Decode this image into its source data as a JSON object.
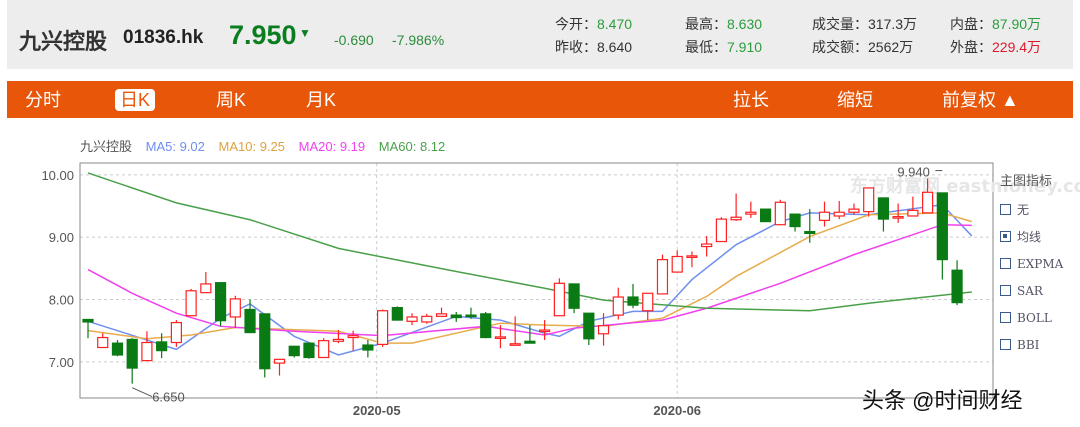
{
  "header": {
    "name": "九兴控股",
    "code": "01836.hk",
    "price": "7.950",
    "direction_icon": "▼",
    "change": "-0.690",
    "change_pct": "-7.986%",
    "stats": [
      {
        "label": "今开：",
        "value": "8.470",
        "color": "green"
      },
      {
        "label": "最高：",
        "value": "8.630",
        "color": "green"
      },
      {
        "label": "成交量：",
        "value": "317.3万",
        "color": "neutral"
      },
      {
        "label": "内盘：",
        "value": "87.90万",
        "color": "green"
      },
      {
        "label": "昨收：",
        "value": "8.640",
        "color": "neutral"
      },
      {
        "label": "最低：",
        "value": "7.910",
        "color": "green"
      },
      {
        "label": "成交额：",
        "value": "2562万",
        "color": "neutral"
      },
      {
        "label": "外盘：",
        "value": "229.4万",
        "color": "red"
      }
    ]
  },
  "toolbar": {
    "tabs": [
      "分时",
      "日K",
      "周K",
      "月K"
    ],
    "active_tab": "日K",
    "actions": [
      "拉长",
      "缩短",
      "前复权 ▲"
    ]
  },
  "legend": {
    "name": "九兴控股",
    "ma5": "MA5: 9.02",
    "ma10": "MA10: 9.25",
    "ma20": "MA20: 9.19",
    "ma60": "MA60: 8.12"
  },
  "indicators": {
    "title": "主图指标",
    "options": [
      {
        "label": "无",
        "checked": false
      },
      {
        "label": "均线",
        "checked": true
      },
      {
        "label": "EXPMA",
        "checked": false
      },
      {
        "label": "SAR",
        "checked": false
      },
      {
        "label": "BOLL",
        "checked": false
      },
      {
        "label": "BBI",
        "checked": false
      }
    ]
  },
  "watermark": "头条 @时间财经",
  "chart_watermark": "东方财富网 eastmoney.com",
  "colors": {
    "up": "#ff2020",
    "down": "#0a7a14",
    "ma5": "#6f8fef",
    "ma10": "#e8ac4c",
    "ma20": "#f040f0",
    "ma60": "#4aa04a",
    "accent": "#e8560a"
  },
  "chart_data": {
    "type": "candlestick",
    "ylim": [
      6.42,
      10.19
    ],
    "yticks": [
      "10.00",
      "9.00",
      "8.00",
      "7.00"
    ],
    "ytick_values": [
      10,
      9,
      8,
      7
    ],
    "xticks": [
      {
        "label": "2020-05",
        "index": 19.6
      },
      {
        "label": "2020-06",
        "index": 40
      }
    ],
    "annotations": [
      {
        "text": "6.650",
        "index": 3,
        "value": 6.65
      },
      {
        "text": "9.940",
        "index": 58,
        "value": 9.94
      }
    ],
    "candles": [
      [
        7.68,
        7.68,
        7.38,
        7.64
      ],
      [
        7.23,
        7.46,
        7.23,
        7.39
      ],
      [
        7.3,
        7.35,
        7.09,
        7.11
      ],
      [
        7.36,
        7.38,
        6.65,
        6.9
      ],
      [
        7.02,
        7.49,
        7.02,
        7.31
      ],
      [
        7.32,
        7.46,
        7.06,
        7.18
      ],
      [
        7.31,
        7.67,
        7.24,
        7.63
      ],
      [
        7.74,
        8.17,
        7.74,
        8.14
      ],
      [
        8.11,
        8.44,
        8.11,
        8.25
      ],
      [
        8.27,
        8.27,
        7.57,
        7.66
      ],
      [
        7.72,
        8.06,
        7.54,
        8.01
      ],
      [
        7.84,
        8.0,
        7.46,
        7.47
      ],
      [
        7.77,
        7.77,
        6.75,
        6.89
      ],
      [
        6.98,
        7.04,
        6.78,
        7.04
      ],
      [
        7.25,
        7.25,
        7.07,
        7.1
      ],
      [
        7.3,
        7.3,
        7.05,
        7.07
      ],
      [
        7.07,
        7.38,
        7.07,
        7.34
      ],
      [
        7.33,
        7.51,
        7.3,
        7.36
      ],
      [
        7.39,
        7.5,
        7.18,
        7.42
      ],
      [
        7.27,
        7.35,
        7.07,
        7.19
      ],
      [
        7.28,
        7.84,
        7.24,
        7.82
      ],
      [
        7.87,
        7.89,
        7.67,
        7.67
      ],
      [
        7.65,
        7.78,
        7.59,
        7.72
      ],
      [
        7.64,
        7.77,
        7.61,
        7.73
      ],
      [
        7.73,
        7.87,
        7.73,
        7.77
      ],
      [
        7.75,
        7.8,
        7.64,
        7.71
      ],
      [
        7.75,
        7.87,
        7.69,
        7.73
      ],
      [
        7.77,
        7.8,
        7.38,
        7.39
      ],
      [
        7.38,
        7.59,
        7.22,
        7.4
      ],
      [
        7.28,
        7.73,
        7.27,
        7.29
      ],
      [
        7.33,
        7.59,
        7.3,
        7.3
      ],
      [
        7.49,
        7.67,
        7.35,
        7.51
      ],
      [
        7.74,
        8.34,
        7.74,
        8.26
      ],
      [
        8.25,
        8.25,
        7.78,
        7.86
      ],
      [
        7.78,
        7.78,
        7.27,
        7.37
      ],
      [
        7.45,
        7.78,
        7.26,
        7.58
      ],
      [
        7.75,
        8.19,
        7.68,
        8.04
      ],
      [
        8.04,
        8.25,
        7.86,
        7.91
      ],
      [
        7.82,
        8.1,
        7.67,
        8.1
      ],
      [
        8.09,
        8.72,
        8.09,
        8.64
      ],
      [
        8.44,
        8.79,
        8.44,
        8.69
      ],
      [
        8.69,
        8.77,
        8.52,
        8.7
      ],
      [
        8.85,
        9.02,
        8.69,
        8.89
      ],
      [
        8.93,
        9.32,
        8.93,
        9.29
      ],
      [
        9.28,
        9.7,
        9.26,
        9.32
      ],
      [
        9.37,
        9.57,
        9.31,
        9.4
      ],
      [
        9.45,
        9.45,
        9.25,
        9.25
      ],
      [
        9.2,
        9.6,
        9.2,
        9.56
      ],
      [
        9.37,
        9.37,
        9.09,
        9.17
      ],
      [
        9.09,
        9.45,
        8.91,
        9.06
      ],
      [
        9.27,
        9.57,
        9.17,
        9.4
      ],
      [
        9.34,
        9.58,
        9.29,
        9.4
      ],
      [
        9.4,
        9.54,
        9.36,
        9.45
      ],
      [
        9.41,
        9.79,
        9.33,
        9.79
      ],
      [
        9.63,
        9.63,
        9.09,
        9.29
      ],
      [
        9.32,
        9.54,
        9.23,
        9.33
      ],
      [
        9.34,
        9.65,
        9.34,
        9.43
      ],
      [
        9.39,
        9.94,
        9.39,
        9.72
      ],
      [
        9.71,
        9.71,
        8.32,
        8.64
      ],
      [
        8.47,
        8.63,
        7.91,
        7.95
      ]
    ],
    "ma_series": [
      {
        "name": "MA5",
        "color_key": "ma5",
        "points": [
          [
            0,
            7.65
          ],
          [
            4,
            7.35
          ],
          [
            6,
            7.2
          ],
          [
            9,
            7.7
          ],
          [
            11,
            7.93
          ],
          [
            14,
            7.41
          ],
          [
            17,
            7.11
          ],
          [
            20,
            7.3
          ],
          [
            25,
            7.73
          ],
          [
            28,
            7.67
          ],
          [
            31,
            7.46
          ],
          [
            32,
            7.41
          ],
          [
            34,
            7.65
          ],
          [
            37,
            7.81
          ],
          [
            39,
            7.81
          ],
          [
            41,
            8.32
          ],
          [
            44,
            8.88
          ],
          [
            47,
            9.25
          ],
          [
            49,
            9.39
          ],
          [
            53,
            9.36
          ],
          [
            58,
            9.52
          ],
          [
            60,
            9.02
          ]
        ]
      },
      {
        "name": "MA10",
        "color_key": "ma10",
        "points": [
          [
            0,
            7.5
          ],
          [
            4,
            7.37
          ],
          [
            7,
            7.43
          ],
          [
            10,
            7.55
          ],
          [
            17,
            7.49
          ],
          [
            20,
            7.3
          ],
          [
            22,
            7.3
          ],
          [
            28,
            7.62
          ],
          [
            31,
            7.59
          ],
          [
            35,
            7.57
          ],
          [
            39,
            7.7
          ],
          [
            42,
            8.05
          ],
          [
            44,
            8.37
          ],
          [
            49,
            9.01
          ],
          [
            53,
            9.36
          ],
          [
            58,
            9.39
          ],
          [
            60,
            9.25
          ]
        ]
      },
      {
        "name": "MA20",
        "color_key": "ma20",
        "points": [
          [
            0,
            8.48
          ],
          [
            3,
            8.1
          ],
          [
            6,
            7.78
          ],
          [
            9,
            7.57
          ],
          [
            14,
            7.49
          ],
          [
            20,
            7.42
          ],
          [
            27,
            7.57
          ],
          [
            31,
            7.43
          ],
          [
            33,
            7.54
          ],
          [
            39,
            7.67
          ],
          [
            42,
            7.86
          ],
          [
            47,
            8.26
          ],
          [
            52,
            8.72
          ],
          [
            58,
            9.2
          ],
          [
            60,
            9.19
          ]
        ]
      },
      {
        "name": "MA60",
        "color_key": "ma60",
        "points": [
          [
            0,
            10.03
          ],
          [
            6,
            9.55
          ],
          [
            11,
            9.28
          ],
          [
            17,
            8.82
          ],
          [
            20,
            8.68
          ],
          [
            25,
            8.45
          ],
          [
            31,
            8.18
          ],
          [
            35,
            7.99
          ],
          [
            42,
            7.86
          ],
          [
            49,
            7.82
          ],
          [
            53,
            7.94
          ],
          [
            60,
            8.12
          ]
        ]
      }
    ]
  }
}
